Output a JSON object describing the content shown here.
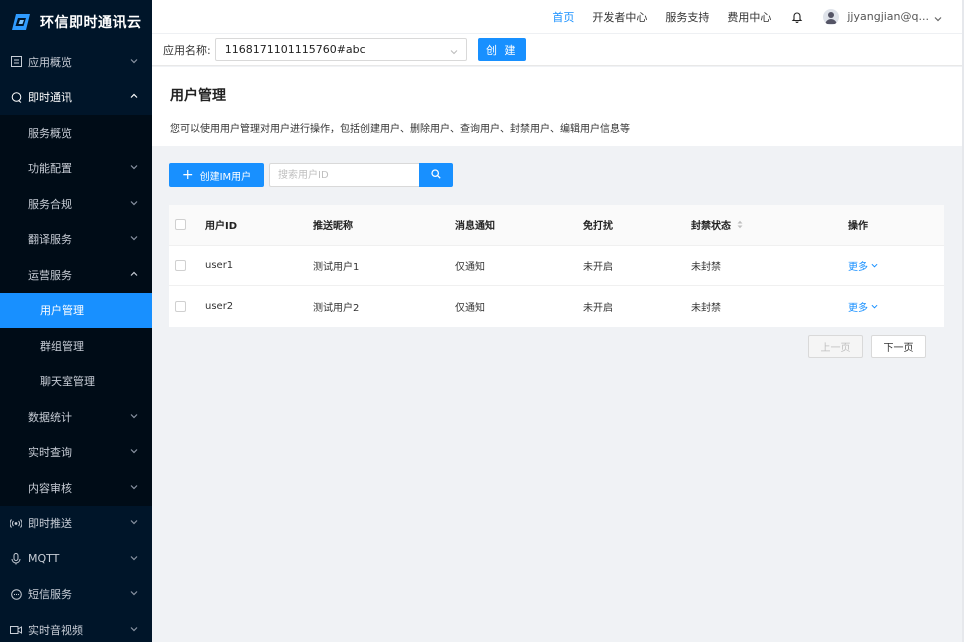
{
  "brand": {
    "name": "环信即时通讯云"
  },
  "sidebar": {
    "items": [
      {
        "label": "应用概览",
        "level": "top",
        "icon": "dashboard-icon",
        "state": "collapsed"
      },
      {
        "label": "即时通讯",
        "level": "top",
        "icon": "chat-icon",
        "state": "expanded"
      },
      {
        "label": "服务概览",
        "level": "sub"
      },
      {
        "label": "功能配置",
        "level": "sub",
        "state": "collapsed"
      },
      {
        "label": "服务合规",
        "level": "sub",
        "state": "collapsed"
      },
      {
        "label": "翻译服务",
        "level": "sub",
        "state": "collapsed"
      },
      {
        "label": "运营服务",
        "level": "sub",
        "state": "expanded"
      },
      {
        "label": "用户管理",
        "level": "subsub",
        "active": true
      },
      {
        "label": "群组管理",
        "level": "subsub"
      },
      {
        "label": "聊天室管理",
        "level": "subsub"
      },
      {
        "label": "数据统计",
        "level": "sub",
        "state": "collapsed"
      },
      {
        "label": "实时查询",
        "level": "sub",
        "state": "collapsed"
      },
      {
        "label": "内容审核",
        "level": "sub",
        "state": "collapsed"
      },
      {
        "label": "即时推送",
        "level": "top",
        "icon": "broadcast-icon",
        "state": "collapsed"
      },
      {
        "label": "MQTT",
        "level": "top",
        "icon": "mic-icon",
        "state": "collapsed"
      },
      {
        "label": "短信服务",
        "level": "top",
        "icon": "message-icon",
        "state": "collapsed"
      },
      {
        "label": "实时音视频",
        "level": "top",
        "icon": "video-icon",
        "state": "collapsed"
      }
    ]
  },
  "topnav": {
    "links": [
      {
        "label": "首页",
        "active": true
      },
      {
        "label": "开发者中心"
      },
      {
        "label": "服务支持"
      },
      {
        "label": "费用中心"
      }
    ],
    "username": "jjyangjian@q..."
  },
  "appbar": {
    "label": "应用名称:",
    "selected_app": "1168171101115760#abc",
    "create_label": "创 建"
  },
  "page": {
    "title": "用户管理",
    "description": "您可以使用用户管理对用户进行操作，包括创建用户、删除用户、查询用户、封禁用户、编辑用户信息等"
  },
  "toolbar": {
    "create_im_user_label": "创建IM用户",
    "search_placeholder": "搜索用户ID"
  },
  "table": {
    "columns": [
      "用户ID",
      "推送昵称",
      "消息通知",
      "免打扰",
      "封禁状态",
      "操作"
    ],
    "rows": [
      {
        "user_id": "user1",
        "nickname": "测试用户1",
        "notify": "仅通知",
        "dnd": "未开启",
        "ban": "未封禁",
        "action": "更多"
      },
      {
        "user_id": "user2",
        "nickname": "测试用户2",
        "notify": "仅通知",
        "dnd": "未开启",
        "ban": "未封禁",
        "action": "更多"
      }
    ]
  },
  "pagination": {
    "prev_label": "上一页",
    "next_label": "下一页"
  },
  "colors": {
    "primary": "#1890ff",
    "sidebar_bg": "#001529",
    "sidebar_sub_bg": "#000c17",
    "content_bg": "#f0f2f5"
  }
}
